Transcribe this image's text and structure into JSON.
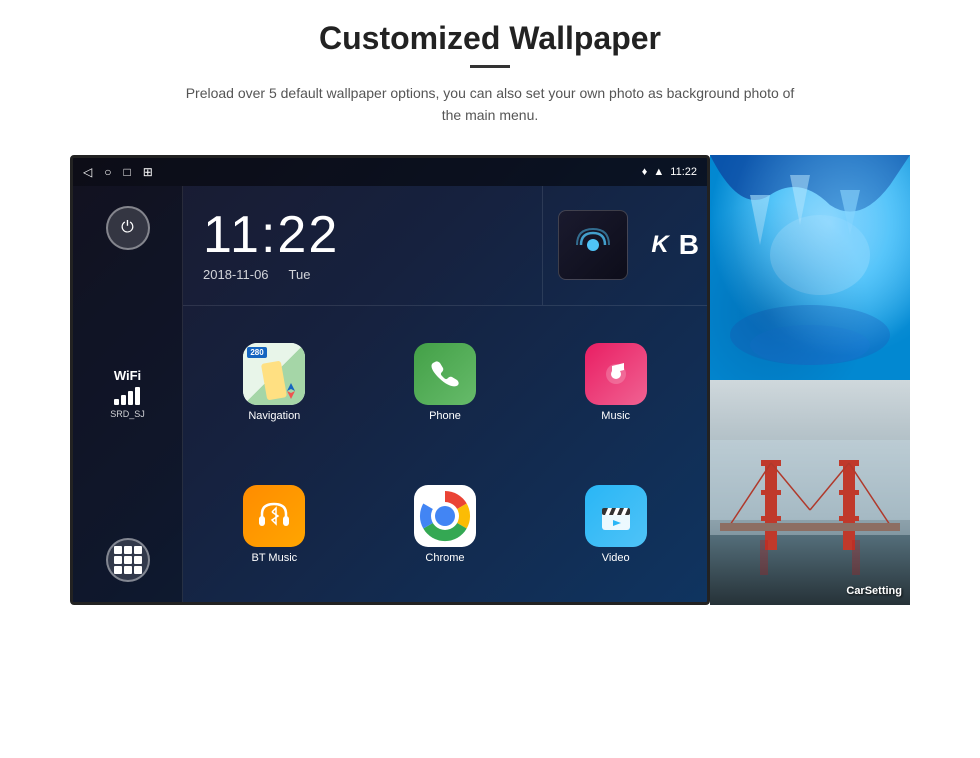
{
  "page": {
    "title": "Customized Wallpaper",
    "divider": "—",
    "subtitle": "Preload over 5 default wallpaper options, you can also set your own photo as background photo of the main menu."
  },
  "statusBar": {
    "time": "11:22",
    "navIcons": [
      "◁",
      "○",
      "□",
      "⊞"
    ],
    "rightIcons": [
      "location",
      "wifi",
      "time"
    ]
  },
  "clockWidget": {
    "time": "11:22",
    "date": "2018-11-06",
    "day": "Tue"
  },
  "wifi": {
    "label": "WiFi",
    "ssid": "SRD_SJ"
  },
  "apps": [
    {
      "name": "Navigation",
      "icon": "nav"
    },
    {
      "name": "Phone",
      "icon": "phone"
    },
    {
      "name": "Music",
      "icon": "music"
    },
    {
      "name": "BT Music",
      "icon": "bt"
    },
    {
      "name": "Chrome",
      "icon": "chrome"
    },
    {
      "name": "Video",
      "icon": "video"
    }
  ],
  "wallpapers": [
    {
      "label": ""
    },
    {
      "label": "CarSetting"
    }
  ]
}
